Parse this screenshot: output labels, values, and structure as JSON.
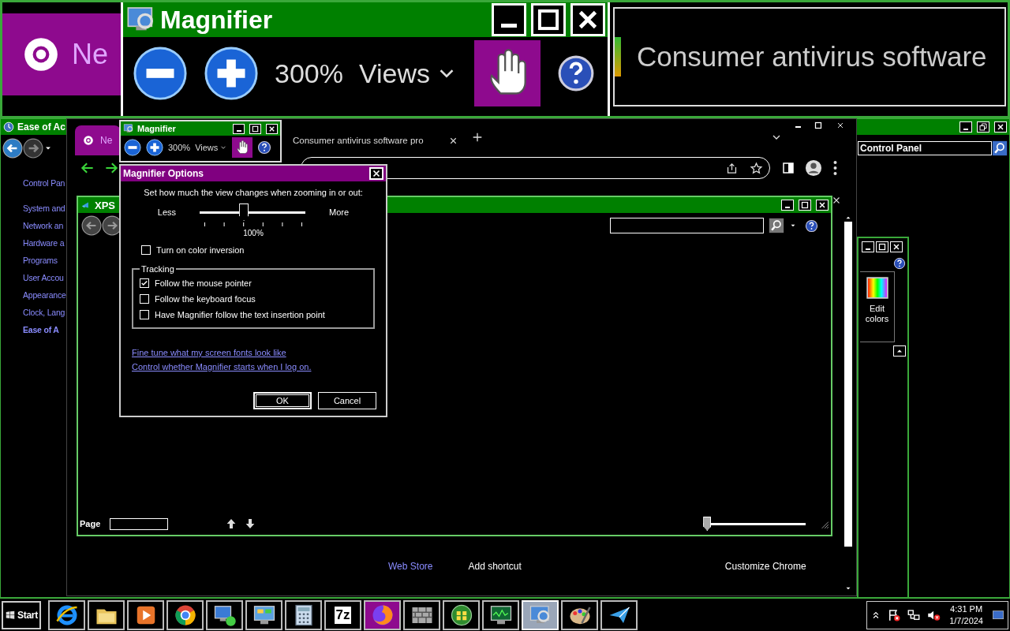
{
  "lens": {
    "tab_label": "Ne",
    "title": "Magnifier",
    "zoom": "300%",
    "views": "Views",
    "page_text": "Consumer antivirus software"
  },
  "control_panel": {
    "title": "Ease of Ac",
    "search_value": "Control Panel",
    "home_link": "Control Pan",
    "categories": [
      {
        "label": "System and",
        "selected": false
      },
      {
        "label": "Network an",
        "selected": false
      },
      {
        "label": "Hardware a",
        "selected": false
      },
      {
        "label": "Programs",
        "selected": false
      },
      {
        "label": "User Accou",
        "selected": false
      },
      {
        "label": "Appearance",
        "selected": false
      },
      {
        "label": "Clock, Lang",
        "selected": false
      },
      {
        "label": "Ease of A",
        "selected": true
      }
    ]
  },
  "browser": {
    "tabs": [
      {
        "label": "Ne",
        "selected": true
      },
      {
        "label": "Consumer antivirus software pro",
        "selected": false
      }
    ],
    "footer_links": [
      {
        "label": "Web Store",
        "kind": "link"
      },
      {
        "label": "Add shortcut",
        "kind": "action"
      },
      {
        "label": "Customize Chrome",
        "kind": "action"
      }
    ]
  },
  "xps": {
    "title": "XPS",
    "page_label": "Page",
    "zoom_slider": {
      "level": 0
    }
  },
  "paint": {
    "edit_colors": "Edit colors"
  },
  "magnifier": {
    "title": "Magnifier",
    "zoom": "300%",
    "views": "Views"
  },
  "options": {
    "title": "Magnifier Options",
    "prompt": "Set how much the view changes when zooming in or out:",
    "less": "Less",
    "more": "More",
    "step": {
      "level": 0.4
    },
    "step_reading": "100%",
    "invert": {
      "label": "Turn on color inversion",
      "checked": false
    },
    "tracking": {
      "title": "Tracking",
      "options": [
        {
          "label": "Follow the mouse pointer",
          "checked": true
        },
        {
          "label": "Follow the keyboard focus",
          "checked": false
        },
        {
          "label": "Have Magnifier follow the text insertion point",
          "checked": false
        }
      ]
    },
    "links": [
      "Fine tune what my screen fonts look like",
      "Control whether Magnifier starts when I log on."
    ],
    "buttons": [
      {
        "label": "OK",
        "default": true
      },
      {
        "label": "Cancel",
        "default": false
      }
    ]
  },
  "taskbar": {
    "start": "Start",
    "apps": [
      {
        "selected": false,
        "highlighted": false
      },
      {
        "selected": false,
        "highlighted": false
      },
      {
        "selected": false,
        "highlighted": false
      },
      {
        "selected": false,
        "highlighted": false
      },
      {
        "selected": false,
        "highlighted": false
      },
      {
        "selected": false,
        "highlighted": false
      },
      {
        "selected": false,
        "highlighted": false
      },
      {
        "label": "7z",
        "selected": false,
        "highlighted": false
      },
      {
        "selected": false,
        "highlighted": true
      },
      {
        "selected": false,
        "highlighted": false
      },
      {
        "selected": false,
        "highlighted": false
      },
      {
        "selected": false,
        "highlighted": false
      },
      {
        "selected": true,
        "highlighted": false
      },
      {
        "selected": false,
        "highlighted": false
      },
      {
        "selected": false,
        "highlighted": false
      }
    ],
    "clock": {
      "time": "4:31 PM",
      "date": "1/7/2024"
    }
  }
}
